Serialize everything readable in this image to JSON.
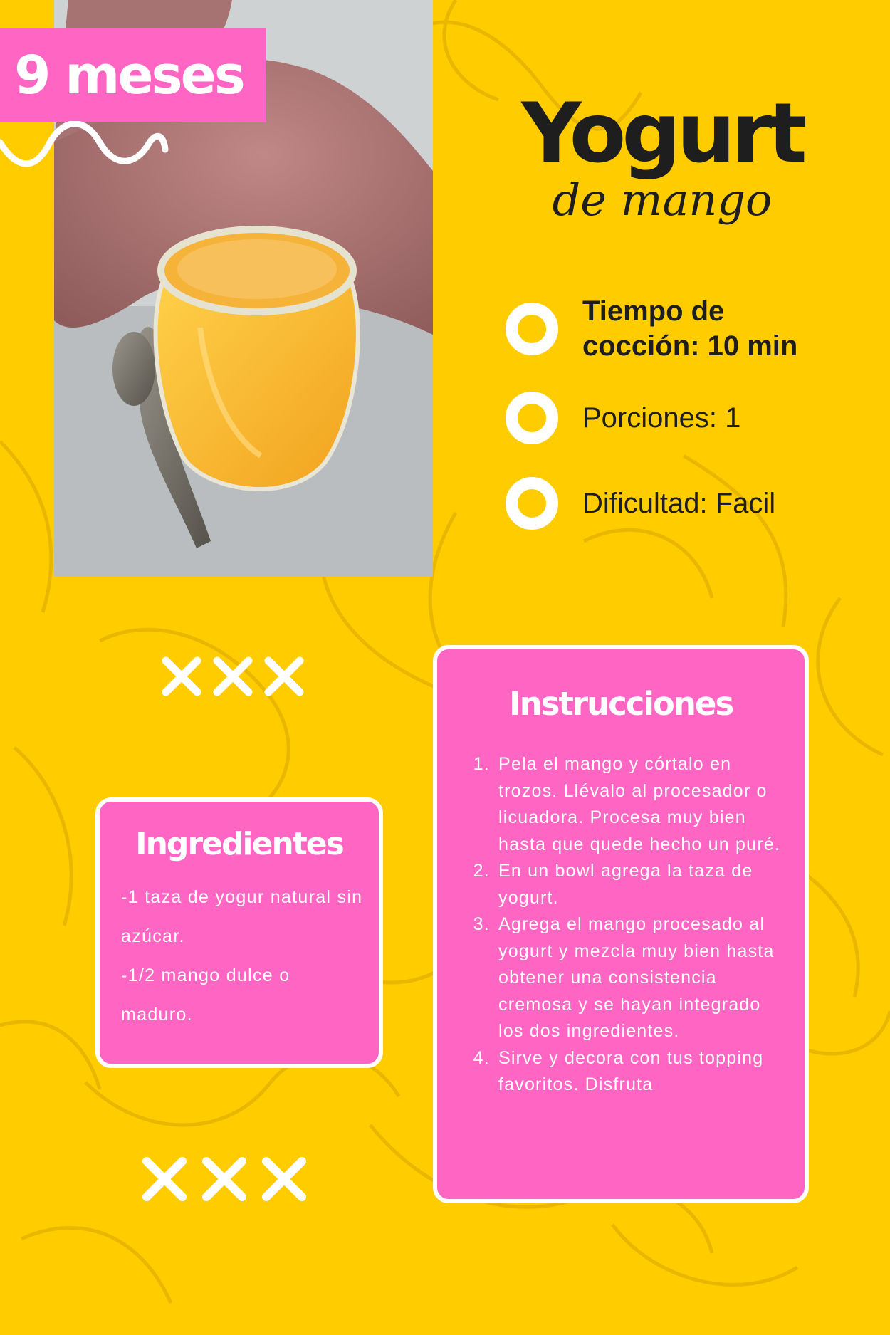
{
  "badge": {
    "age": "9 meses"
  },
  "title": {
    "main": "Yogurt",
    "sub": "de mango"
  },
  "info": [
    {
      "text": "Tiempo de cocción: 10 min"
    },
    {
      "text": "Porciones: 1"
    },
    {
      "text": "Dificultad: Facil"
    }
  ],
  "ingredients": {
    "title": "Ingredientes",
    "items": [
      "-1 taza de yogur natural sin azúcar.",
      "-1/2 mango dulce o maduro."
    ]
  },
  "instructions": {
    "title": "Instrucciones",
    "steps": [
      "Pela el mango y córtalo en trozos. Llévalo al procesador o licuadora. Procesa muy bien hasta que quede hecho un puré.",
      "En un bowl agrega la taza de yogurt.",
      "Agrega el mango procesado al yogurt y mezcla muy bien hasta obtener una consistencia cremosa y se hayan integrado los dos ingredientes.",
      "Sirve y decora con tus topping favoritos. Disfruta"
    ]
  },
  "colors": {
    "background": "#FFCC00",
    "accent_pink": "#FF66C4",
    "text_dark": "#1E1E1E",
    "white": "#FFFFFF"
  }
}
